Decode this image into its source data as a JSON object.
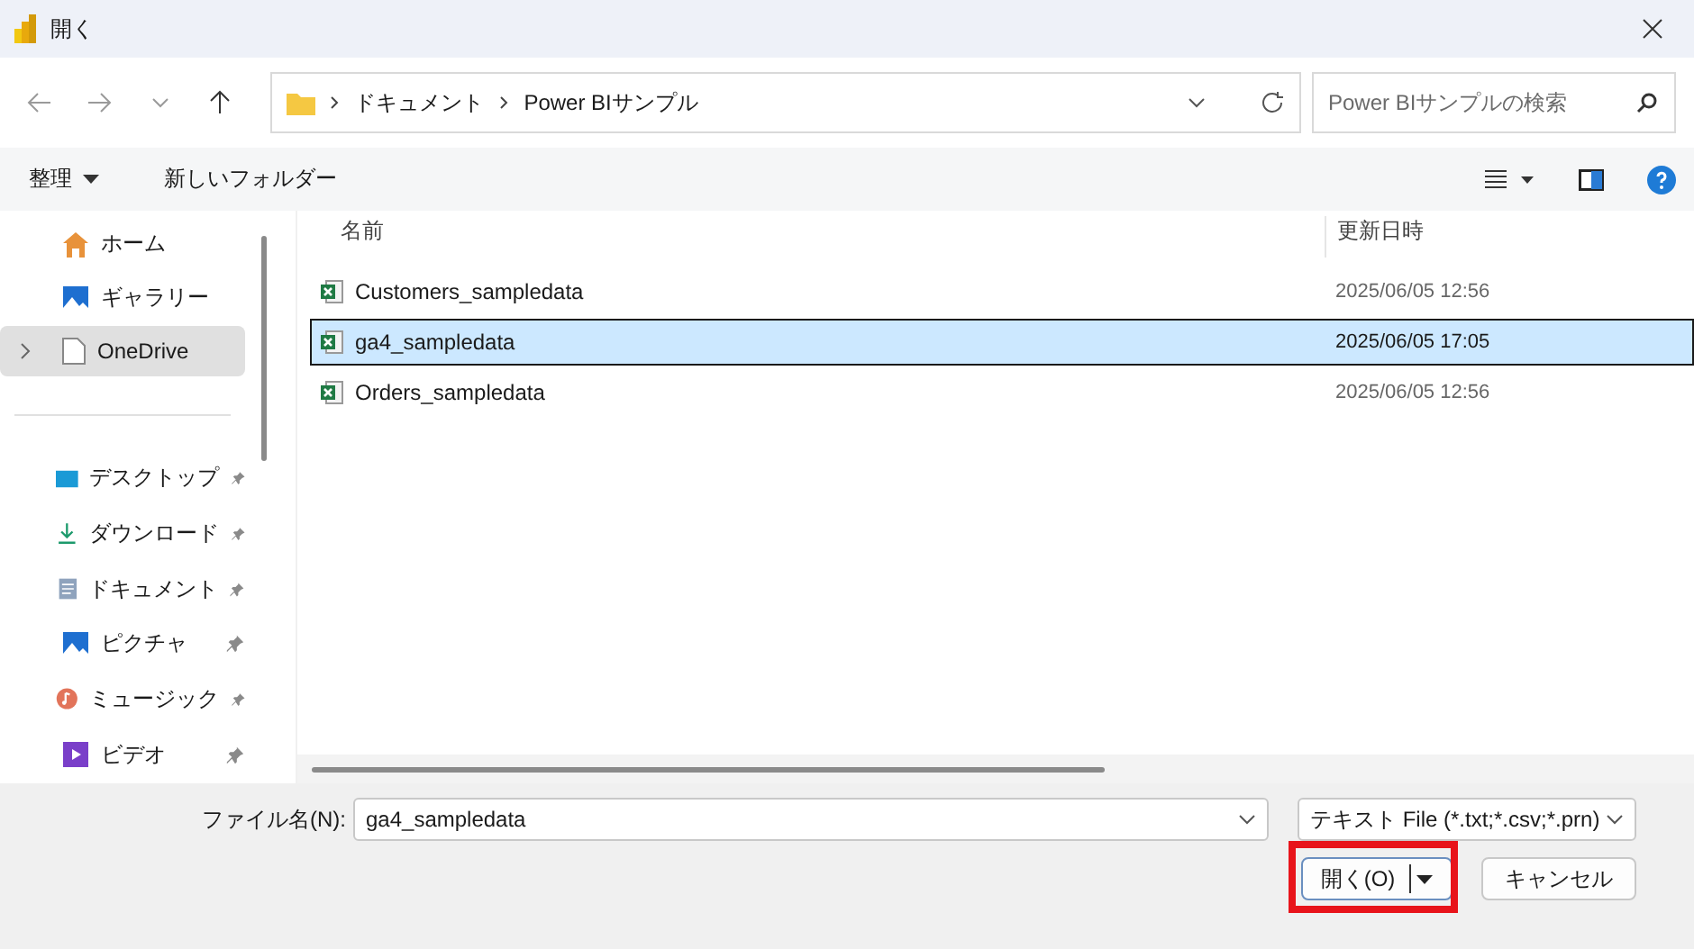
{
  "window": {
    "title": "開く"
  },
  "navigation": {
    "breadcrumbs": [
      "ドキュメント",
      "Power BIサンプル"
    ],
    "search": {
      "placeholder": "Power BIサンプルの検索"
    }
  },
  "command_bar": {
    "organize": "整理",
    "new_folder": "新しいフォルダー"
  },
  "sidebar": {
    "items": [
      {
        "label": "ホーム",
        "selected": false,
        "pinned": false,
        "expandable": false
      },
      {
        "label": "ギャラリー",
        "selected": false,
        "pinned": false,
        "expandable": false
      },
      {
        "label": "OneDrive",
        "selected": true,
        "pinned": false,
        "expandable": true
      }
    ],
    "quick_access": [
      {
        "label": "デスクトップ",
        "selected": false,
        "pinned": true,
        "expandable": false
      },
      {
        "label": "ダウンロード",
        "selected": false,
        "pinned": true,
        "expandable": false
      },
      {
        "label": "ドキュメント",
        "selected": false,
        "pinned": true,
        "expandable": false
      },
      {
        "label": "ピクチャ",
        "selected": false,
        "pinned": true,
        "expandable": false
      },
      {
        "label": "ミュージック",
        "selected": false,
        "pinned": true,
        "expandable": false
      },
      {
        "label": "ビデオ",
        "selected": false,
        "pinned": true,
        "expandable": false
      }
    ]
  },
  "table": {
    "columns": [
      "名前",
      "更新日時"
    ],
    "rows": [
      {
        "name": "Customers_sampledata",
        "modified": "2025/06/05 12:56",
        "selected": false
      },
      {
        "name": "ga4_sampledata",
        "modified": "2025/06/05 17:05",
        "selected": true
      },
      {
        "name": "Orders_sampledata",
        "modified": "2025/06/05 12:56",
        "selected": false
      }
    ]
  },
  "footer": {
    "file_name_label": "ファイル名(N):",
    "file_name": "ga4_sampledata",
    "file_type": "テキスト File (*.txt;*.csv;*.prn)",
    "open_button": {
      "label": "開く(O)",
      "highlighted": true
    },
    "cancel_button": "キャンセル"
  }
}
